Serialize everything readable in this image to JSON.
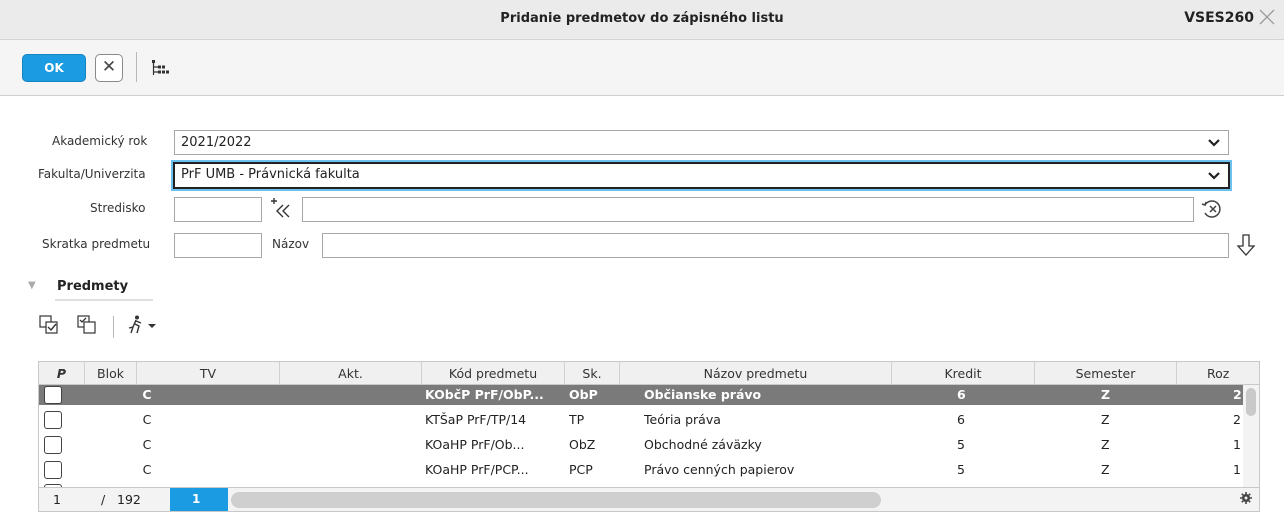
{
  "window": {
    "title": "Pridanie predmetov do zápisného listu",
    "code": "VSES260",
    "close_icon": "close-icon"
  },
  "toolbar": {
    "ok_label": "OK",
    "cancel_label": "✕",
    "tree_icon": "hierarchy-icon"
  },
  "form": {
    "academic_year": {
      "label": "Akademický rok",
      "value": "2021/2022"
    },
    "faculty": {
      "label": "Fakulta/Univerzita",
      "value": "PrF UMB - Právnická fakulta"
    },
    "center": {
      "label": "Stredisko",
      "code_value": "",
      "name_value": "",
      "add_icon": "add-left-icon",
      "clear_icon": "clear-icon"
    },
    "subject": {
      "label": "Skratka predmetu",
      "value": "",
      "name_label": "Názov",
      "name_value": "",
      "download_icon": "arrow-down-icon"
    }
  },
  "section": {
    "title": "Predmety"
  },
  "grid": {
    "columns": [
      "P",
      "Blok",
      "TV",
      "Akt.",
      "Kód predmetu",
      "Sk.",
      "Názov predmetu",
      "Kredit",
      "Semester",
      "Roz"
    ],
    "rows": [
      {
        "checked": false,
        "blok": "",
        "tv": "C",
        "akt": "",
        "kod": "KObčP PrF/ObP...",
        "sk": "ObP",
        "nazov": "Občianske právo",
        "kredit": "6",
        "semester": "Z",
        "roz": "2",
        "selected": true
      },
      {
        "checked": false,
        "blok": "",
        "tv": "C",
        "akt": "",
        "kod": "KTŠaP PrF/TP/14",
        "sk": "TP",
        "nazov": "Teória práva",
        "kredit": "6",
        "semester": "Z",
        "roz": "2",
        "selected": false
      },
      {
        "checked": false,
        "blok": "",
        "tv": "C",
        "akt": "",
        "kod": "KOaHP PrF/Ob...",
        "sk": "ObZ",
        "nazov": "Obchodné záväzky",
        "kredit": "5",
        "semester": "Z",
        "roz": "1",
        "selected": false
      },
      {
        "checked": false,
        "blok": "",
        "tv": "C",
        "akt": "",
        "kod": "KOaHP PrF/PCP...",
        "sk": "PCP",
        "nazov": "Právo cenných papierov",
        "kredit": "5",
        "semester": "Z",
        "roz": "1",
        "selected": false
      }
    ]
  },
  "footer": {
    "current_row": "1",
    "slash": "/",
    "total": "192",
    "page": "1"
  },
  "colors": {
    "accent": "#1a9be2",
    "selected_row": "#7a7a7a"
  }
}
